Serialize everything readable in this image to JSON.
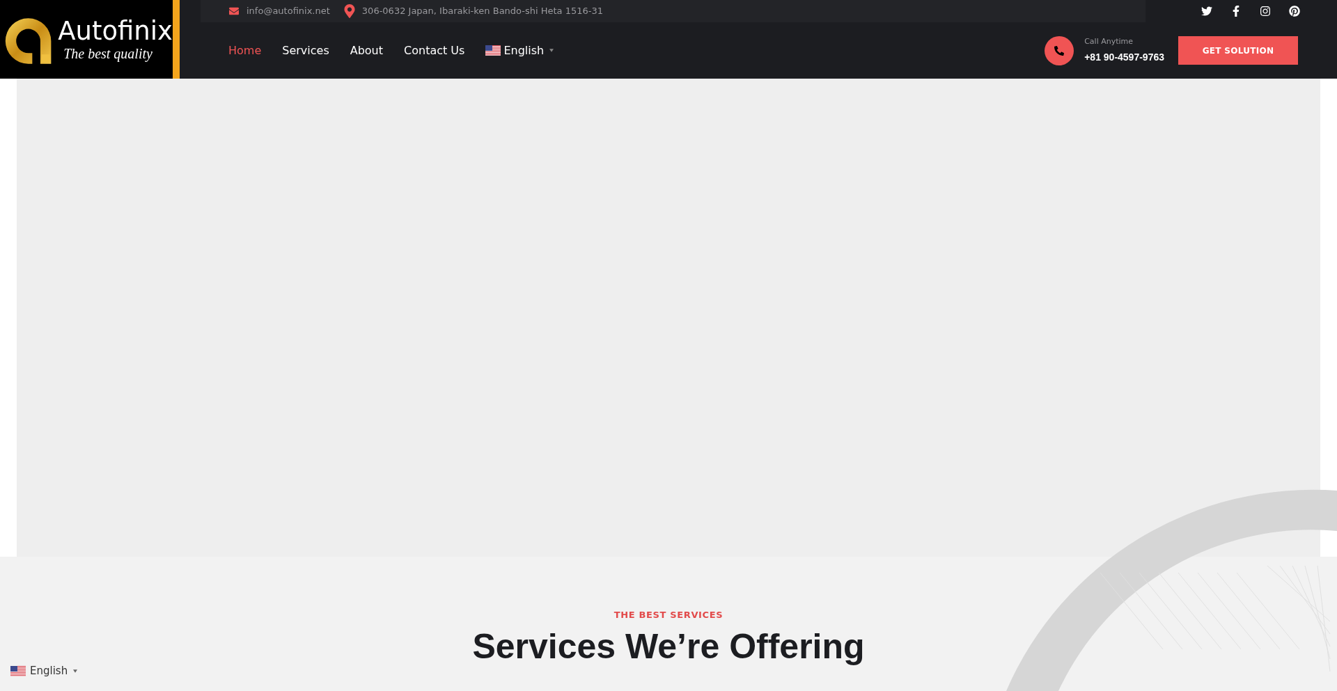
{
  "logo": {
    "name": "Autofinix",
    "tagline": "The best quality"
  },
  "topbar": {
    "email": "info@autofinix.net",
    "address": "306-0632 Japan, Ibaraki-ken Bando-shi Heta 1516-31"
  },
  "nav": [
    {
      "label": "Home",
      "selected": true
    },
    {
      "label": "Services",
      "selected": false
    },
    {
      "label": "About",
      "selected": false
    },
    {
      "label": "Contact Us",
      "selected": false
    }
  ],
  "language": {
    "label": "English"
  },
  "call": {
    "label": "Call Anytime",
    "number": "+81 90-4597-9763"
  },
  "cta": "GET SOLUTION",
  "services": {
    "eyebrow": "THE BEST SERVICES",
    "heading": "Services We’re Offering"
  },
  "language_switcher": {
    "label": "English"
  }
}
